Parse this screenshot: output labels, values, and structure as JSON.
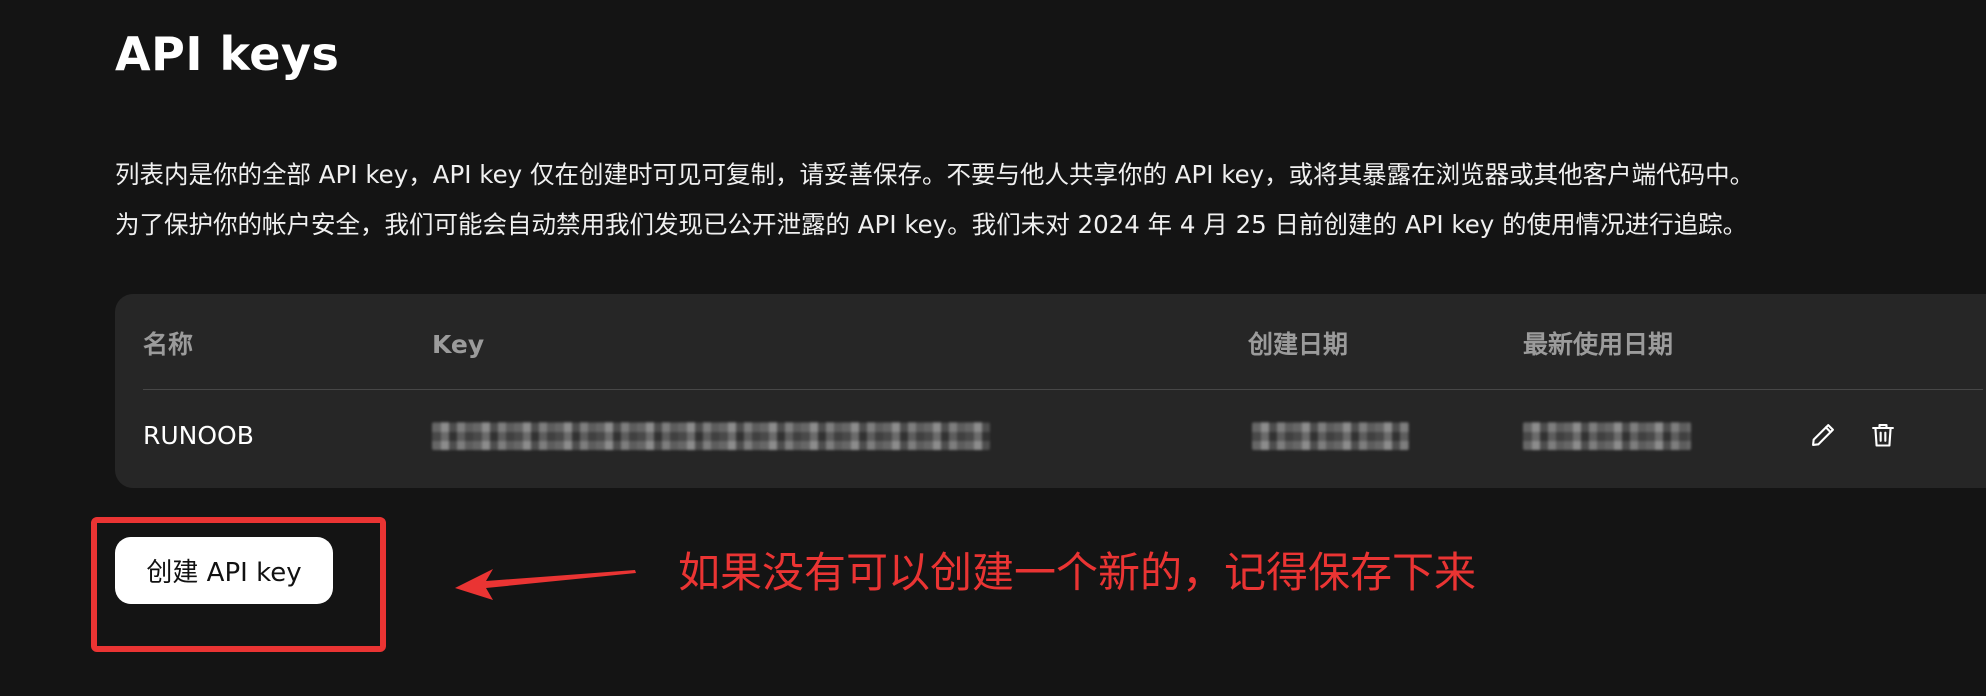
{
  "page": {
    "title": "API keys",
    "description_lines": [
      "列表内是你的全部 API key，API key 仅在创建时可见可复制，请妥善保存。不要与他人共享你的 API key，或将其暴露在浏览器或其他客户端代码中。",
      "为了保护你的帐户安全，我们可能会自动禁用我们发现已公开泄露的 API key。我们未对 2024 年 4 月 25 日前创建的 API key 的使用情况进行追踪。"
    ]
  },
  "table": {
    "columns": {
      "name": "名称",
      "key": "Key",
      "created": "创建日期",
      "last_used": "最新使用日期"
    },
    "rows": [
      {
        "name": "RUNOOB",
        "key_redacted": true,
        "created_redacted": true,
        "last_used_redacted": true,
        "actions": [
          "pencil-icon",
          "trash-icon"
        ]
      }
    ]
  },
  "actions": {
    "create_button_label": "创建 API key"
  },
  "annotation": {
    "text": "如果没有可以创建一个新的，记得保存下来",
    "color": "#ea3433"
  },
  "colors": {
    "background": "#141414",
    "table_background": "#262626",
    "header_text": "#9b9b9b",
    "button_background": "#ffffff"
  }
}
